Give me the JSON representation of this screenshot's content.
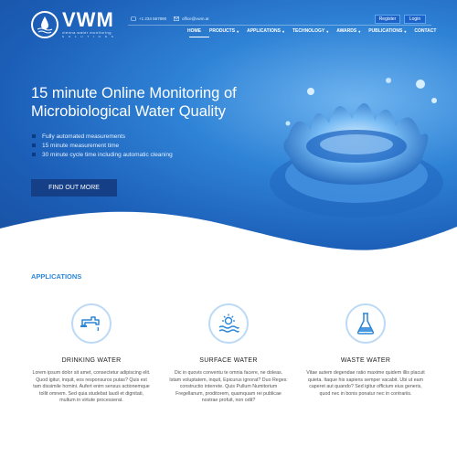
{
  "logo": {
    "name": "VWM",
    "subtitle": "vienna water monitoring",
    "tagline": "S O L U T I O N S"
  },
  "contact": {
    "phone": "+1 234 567890",
    "email": "office@vwm.at"
  },
  "auth": {
    "register": "Register",
    "login": "Login"
  },
  "nav": [
    {
      "label": "HOME",
      "dropdown": false
    },
    {
      "label": "PRODUCTS",
      "dropdown": true
    },
    {
      "label": "APPLICATIONS",
      "dropdown": true
    },
    {
      "label": "TECHNOLOGY",
      "dropdown": true
    },
    {
      "label": "AWARDS",
      "dropdown": true
    },
    {
      "label": "PUBLICATIONS",
      "dropdown": true
    },
    {
      "label": "CONTACT",
      "dropdown": false
    }
  ],
  "hero": {
    "title_line1": "15 minute Online Monitoring of",
    "title_line2": "Microbiological Water Quality",
    "bullets": [
      "Fully automated measurements",
      "15 minute measurement time",
      "30 minute cycle time including automatic cleaning"
    ],
    "cta": "FIND OUT MORE"
  },
  "applications": {
    "heading": "APPLICATIONS",
    "items": [
      {
        "icon": "faucet-icon",
        "title": "DRINKING WATER",
        "text": "Lorem ipsum dolor sit amet, consectetur adipiscing elit. Quod igitur, inquit, eos responsuros putas? Quis est tam dissimile homini. Aufert enim sensus actionemque tollit omnem. Sed quia studebat laudi et dignitati, multum in virtute processerat."
      },
      {
        "icon": "sun-water-icon",
        "title": "SURFACE WATER",
        "text": "Dic in quovis conventu te omnia facere, ne doleas. Istam voluptatem, inquit, Epicurus ignorat? Duo Reges: constructio interrete. Quis Pullum Numitorium Fregellanum, proditorem, quamquam rei publicae nostrae profuit, non odit?"
      },
      {
        "icon": "flask-icon",
        "title": "WASTE WATER",
        "text": "Vitae autem degendae ratio maxime quidem illis placuit quieta. Itaque his sapiens semper vacabit. Ubi ut eam caperet aut quando? Sed igitur officium eius generis, quod nec in bonis ponatur nec in contrariis."
      }
    ]
  },
  "colors": {
    "accent": "#2b86d9",
    "hero_dark": "#184f9f",
    "cta": "#153f86"
  }
}
